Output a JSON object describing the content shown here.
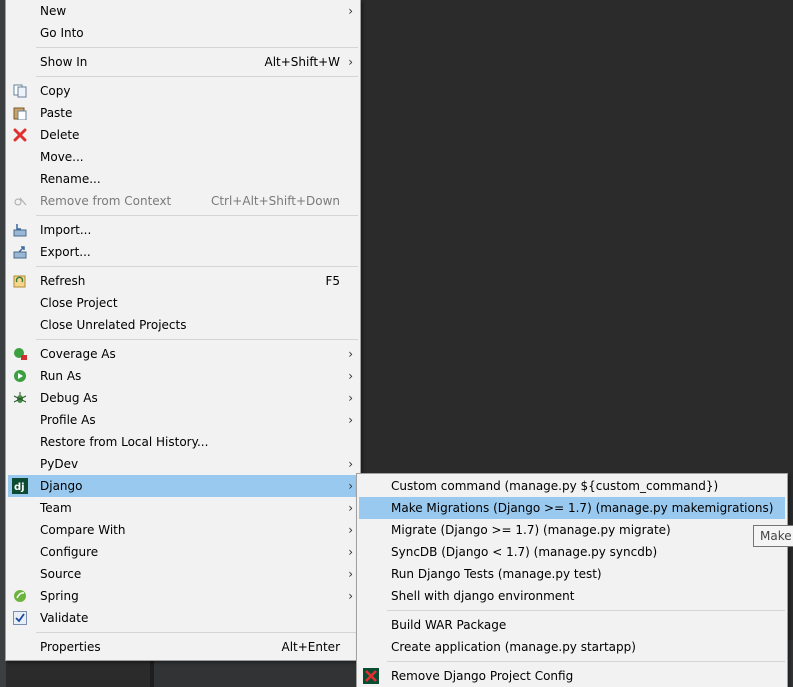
{
  "main_menu": {
    "items": [
      {
        "label": "New",
        "shortcut": "",
        "submenu": true,
        "icon": "",
        "disabled": false
      },
      {
        "label": "Go Into",
        "shortcut": "",
        "submenu": false,
        "icon": "",
        "disabled": false
      },
      {
        "label": "Show In",
        "shortcut": "Alt+Shift+W",
        "submenu": true,
        "icon": "",
        "disabled": false
      },
      {
        "label": "Copy",
        "shortcut": "",
        "submenu": false,
        "icon": "copy-icon",
        "disabled": false
      },
      {
        "label": "Paste",
        "shortcut": "",
        "submenu": false,
        "icon": "paste-icon",
        "disabled": false
      },
      {
        "label": "Delete",
        "shortcut": "",
        "submenu": false,
        "icon": "delete-icon",
        "disabled": false
      },
      {
        "label": "Move...",
        "shortcut": "",
        "submenu": false,
        "icon": "",
        "disabled": false
      },
      {
        "label": "Rename...",
        "shortcut": "",
        "submenu": false,
        "icon": "",
        "disabled": false
      },
      {
        "label": "Remove from Context",
        "shortcut": "Ctrl+Alt+Shift+Down",
        "submenu": false,
        "icon": "remove-context-icon",
        "disabled": true
      },
      {
        "label": "Import...",
        "shortcut": "",
        "submenu": false,
        "icon": "import-icon",
        "disabled": false
      },
      {
        "label": "Export...",
        "shortcut": "",
        "submenu": false,
        "icon": "export-icon",
        "disabled": false
      },
      {
        "label": "Refresh",
        "shortcut": "F5",
        "submenu": false,
        "icon": "refresh-icon",
        "disabled": false
      },
      {
        "label": "Close Project",
        "shortcut": "",
        "submenu": false,
        "icon": "",
        "disabled": false
      },
      {
        "label": "Close Unrelated Projects",
        "shortcut": "",
        "submenu": false,
        "icon": "",
        "disabled": false
      },
      {
        "label": "Coverage As",
        "shortcut": "",
        "submenu": true,
        "icon": "coverage-icon",
        "disabled": false
      },
      {
        "label": "Run As",
        "shortcut": "",
        "submenu": true,
        "icon": "run-icon",
        "disabled": false
      },
      {
        "label": "Debug As",
        "shortcut": "",
        "submenu": true,
        "icon": "debug-icon",
        "disabled": false
      },
      {
        "label": "Profile As",
        "shortcut": "",
        "submenu": true,
        "icon": "",
        "disabled": false
      },
      {
        "label": "Restore from Local History...",
        "shortcut": "",
        "submenu": false,
        "icon": "",
        "disabled": false
      },
      {
        "label": "PyDev",
        "shortcut": "",
        "submenu": true,
        "icon": "",
        "disabled": false
      },
      {
        "label": "Django",
        "shortcut": "",
        "submenu": true,
        "icon": "django-icon",
        "disabled": false,
        "highlighted": true
      },
      {
        "label": "Team",
        "shortcut": "",
        "submenu": true,
        "icon": "",
        "disabled": false
      },
      {
        "label": "Compare With",
        "shortcut": "",
        "submenu": true,
        "icon": "",
        "disabled": false
      },
      {
        "label": "Configure",
        "shortcut": "",
        "submenu": true,
        "icon": "",
        "disabled": false
      },
      {
        "label": "Source",
        "shortcut": "",
        "submenu": true,
        "icon": "",
        "disabled": false
      },
      {
        "label": "Spring",
        "shortcut": "",
        "submenu": true,
        "icon": "spring-icon",
        "disabled": false
      },
      {
        "label": "Validate",
        "shortcut": "",
        "submenu": false,
        "icon": "validate-check-icon",
        "disabled": false
      },
      {
        "label": "Properties",
        "shortcut": "Alt+Enter",
        "submenu": false,
        "icon": "",
        "disabled": false
      }
    ]
  },
  "django_submenu": {
    "items": [
      {
        "label": "Custom command (manage.py ${custom_command})",
        "icon": ""
      },
      {
        "label": "Make Migrations (Django >= 1.7) (manage.py makemigrations)",
        "icon": "",
        "highlighted": true
      },
      {
        "label": "Migrate (Django >= 1.7) (manage.py migrate)",
        "icon": ""
      },
      {
        "label": "SyncDB (Django < 1.7) (manage.py syncdb)",
        "icon": ""
      },
      {
        "label": "Run Django Tests (manage.py test)",
        "icon": ""
      },
      {
        "label": "Shell with django environment",
        "icon": ""
      },
      {
        "label": "Build WAR Package",
        "icon": ""
      },
      {
        "label": "Create application (manage.py startapp)",
        "icon": ""
      },
      {
        "label": "Remove Django Project Config",
        "icon": "remove-config-icon"
      }
    ]
  },
  "tooltip": {
    "text": "Make Migrations"
  },
  "colors": {
    "menu_bg": "#f2f2f2",
    "highlight": "#99c9ef",
    "ide_bg": "#2b2b2b"
  }
}
